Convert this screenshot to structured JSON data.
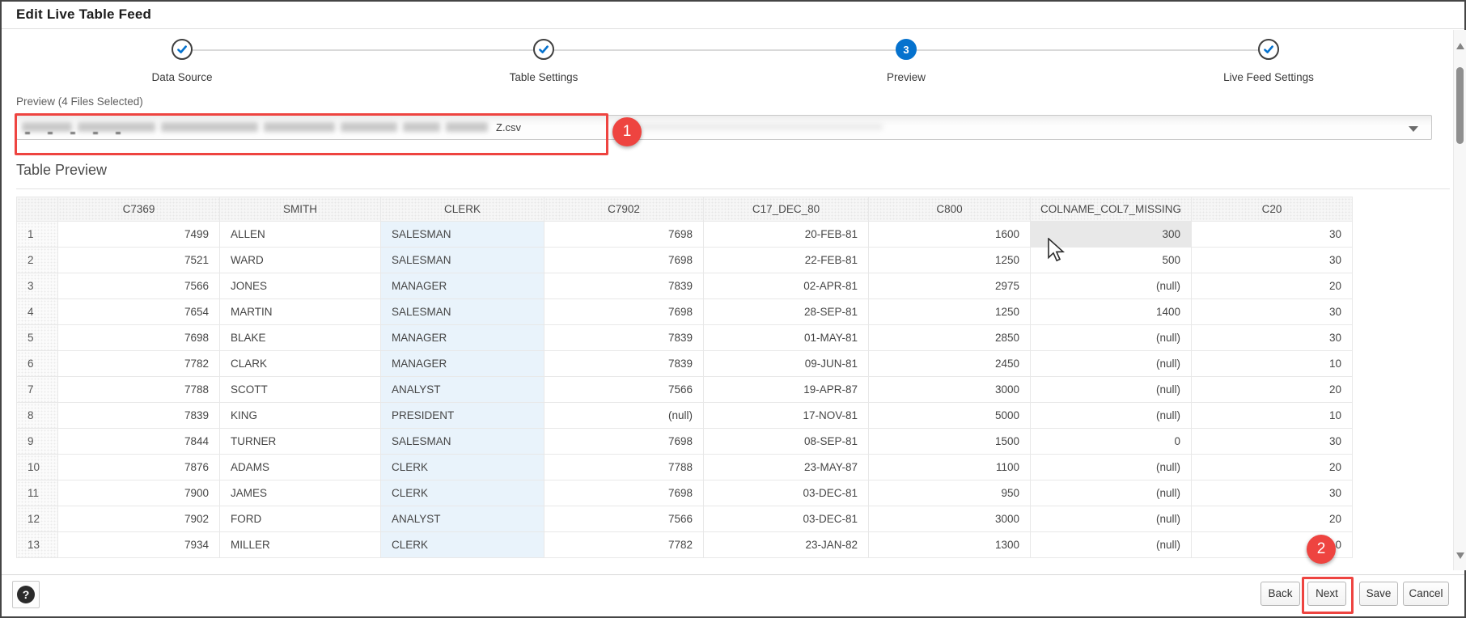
{
  "window": {
    "title": "Edit Live Table Feed"
  },
  "stepper": {
    "steps": [
      {
        "label": "Data Source",
        "state": "complete"
      },
      {
        "label": "Table Settings",
        "state": "complete"
      },
      {
        "label": "Preview",
        "state": "current",
        "number": "3"
      },
      {
        "label": "Live Feed Settings",
        "state": "complete"
      }
    ]
  },
  "preview": {
    "label": "Preview (4 Files Selected)",
    "selected_file_visible_text": "Z.csv"
  },
  "table_preview": {
    "heading": "Table Preview",
    "columns": [
      "C7369",
      "SMITH",
      "CLERK",
      "C7902",
      "C17_DEC_80",
      "C800",
      "COLNAME_COL7_MISSING",
      "C20"
    ],
    "rows": [
      [
        "7499",
        "ALLEN",
        "SALESMAN",
        "7698",
        "20-FEB-81",
        "1600",
        "300",
        "30"
      ],
      [
        "7521",
        "WARD",
        "SALESMAN",
        "7698",
        "22-FEB-81",
        "1250",
        "500",
        "30"
      ],
      [
        "7566",
        "JONES",
        "MANAGER",
        "7839",
        "02-APR-81",
        "2975",
        "(null)",
        "20"
      ],
      [
        "7654",
        "MARTIN",
        "SALESMAN",
        "7698",
        "28-SEP-81",
        "1250",
        "1400",
        "30"
      ],
      [
        "7698",
        "BLAKE",
        "MANAGER",
        "7839",
        "01-MAY-81",
        "2850",
        "(null)",
        "30"
      ],
      [
        "7782",
        "CLARK",
        "MANAGER",
        "7839",
        "09-JUN-81",
        "2450",
        "(null)",
        "10"
      ],
      [
        "7788",
        "SCOTT",
        "ANALYST",
        "7566",
        "19-APR-87",
        "3000",
        "(null)",
        "20"
      ],
      [
        "7839",
        "KING",
        "PRESIDENT",
        "(null)",
        "17-NOV-81",
        "5000",
        "(null)",
        "10"
      ],
      [
        "7844",
        "TURNER",
        "SALESMAN",
        "7698",
        "08-SEP-81",
        "1500",
        "0",
        "30"
      ],
      [
        "7876",
        "ADAMS",
        "CLERK",
        "7788",
        "23-MAY-87",
        "1100",
        "(null)",
        "20"
      ],
      [
        "7900",
        "JAMES",
        "CLERK",
        "7698",
        "03-DEC-81",
        "950",
        "(null)",
        "30"
      ],
      [
        "7902",
        "FORD",
        "ANALYST",
        "7566",
        "03-DEC-81",
        "3000",
        "(null)",
        "20"
      ],
      [
        "7934",
        "MILLER",
        "CLERK",
        "7782",
        "23-JAN-82",
        "1300",
        "(null)",
        "10"
      ]
    ],
    "highlighted_column_index": 2,
    "hovered_cell": {
      "row_index": 0,
      "col_index": 6
    }
  },
  "annotations": {
    "badge_1": "1",
    "badge_2": "2"
  },
  "footer": {
    "help_label": "?",
    "buttons": {
      "back": "Back",
      "next": "Next",
      "save": "Save",
      "cancel": "Cancel"
    }
  },
  "colors": {
    "accent_blue": "#0572ce",
    "annotation_red": "#ee4440",
    "column_highlight": "#e9f3fb",
    "hover_cell": "#e8e8e8"
  }
}
